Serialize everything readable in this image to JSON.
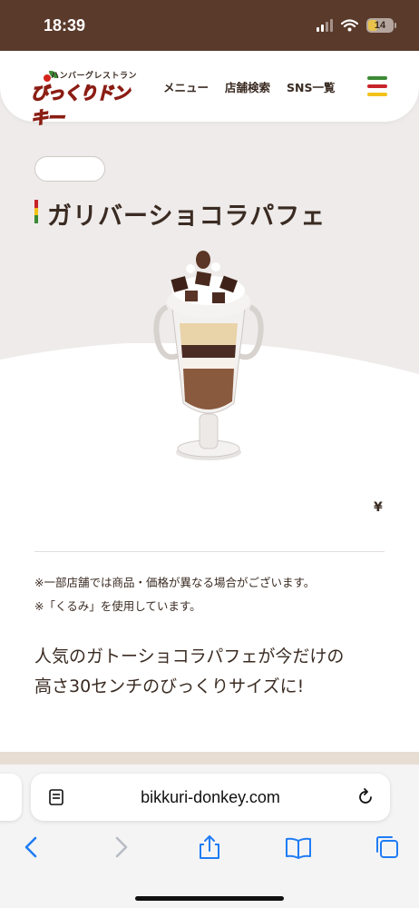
{
  "status": {
    "time": "18:39",
    "battery": "14"
  },
  "header": {
    "logo_small": "ハンバーグレストラン",
    "logo_main": "びっくりドンキー",
    "nav": [
      "メニュー",
      "店舗検索",
      "SNS一覧"
    ],
    "menu_colors": [
      "#3c8a35",
      "#c7242b",
      "#f2c21a"
    ]
  },
  "product": {
    "badge": "",
    "title": "ガリバーショコラパフェ",
    "price_symbol": "¥",
    "notes": [
      "※一部店舗では商品・価格が異なる場合がございます。",
      "※「くるみ」を使用しています。"
    ],
    "description": [
      "人気のガトーショコラパフェが今だけの",
      "高さ30センチのびっくりサイズに!"
    ]
  },
  "browser": {
    "url": "bikkuri-donkey.com"
  },
  "colors": {
    "brand_brown": "#5a3a2b",
    "page_bg": "#eeebea",
    "ios_blue": "#1f7cf5"
  }
}
